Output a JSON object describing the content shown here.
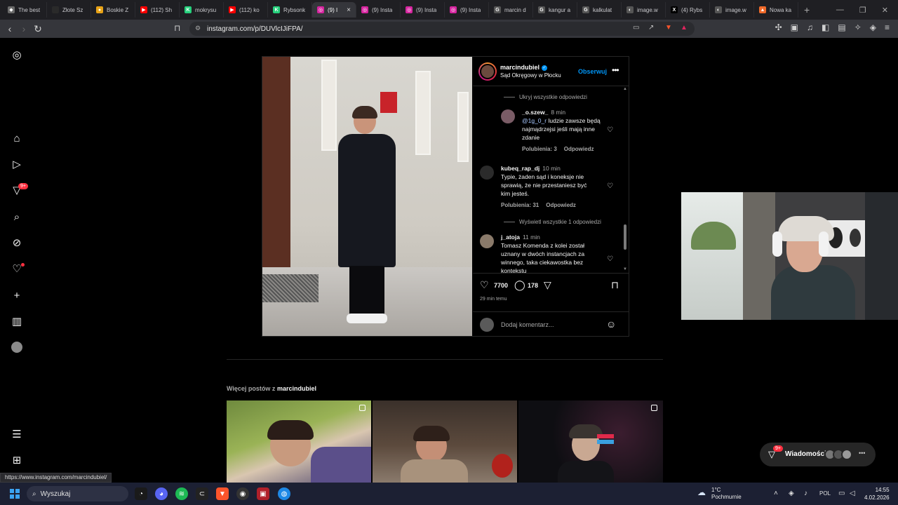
{
  "browser": {
    "tabs": [
      {
        "title": "The best",
        "color": "#6a6a6a",
        "glyph": "◆"
      },
      {
        "title": "Złote Sz",
        "color": "#2a2a2a",
        "glyph": ""
      },
      {
        "title": "Boskie Z",
        "color": "#e8a317",
        "glyph": "●"
      },
      {
        "title": "(112) Sh",
        "color": "#ff0000",
        "glyph": "▶"
      },
      {
        "title": "mokrysu",
        "color": "#26d07c",
        "glyph": "K"
      },
      {
        "title": "(112) ko",
        "color": "#ff0000",
        "glyph": "▶"
      },
      {
        "title": "Rybsonk",
        "color": "#26d07c",
        "glyph": "K"
      },
      {
        "title": "(9) I",
        "color": "#d6249f",
        "glyph": "◎",
        "active": true
      },
      {
        "title": "(9) Insta",
        "color": "#d6249f",
        "glyph": "◎"
      },
      {
        "title": "(9) Insta",
        "color": "#d6249f",
        "glyph": "◎"
      },
      {
        "title": "(9) Insta",
        "color": "#d6249f",
        "glyph": "◎"
      },
      {
        "title": "marcin d",
        "color": "#555",
        "glyph": "G"
      },
      {
        "title": "kangur a",
        "color": "#555",
        "glyph": "G"
      },
      {
        "title": "kalkulat",
        "color": "#555",
        "glyph": "G"
      },
      {
        "title": "image.w",
        "color": "#555",
        "glyph": "◐"
      },
      {
        "title": "(4) Rybs",
        "color": "#000",
        "glyph": "X"
      },
      {
        "title": "image.w",
        "color": "#555",
        "glyph": "◐"
      },
      {
        "title": "Nowa ka",
        "color": "#f06a2a",
        "glyph": "▲"
      }
    ],
    "url": "instagram.com/p/DUVlcIJiFPA/",
    "status_url": "https://www.instagram.com/marcindubiel/"
  },
  "post": {
    "username": "marcindubiel",
    "location": "Sąd Okręgowy w Płocku",
    "follow_label": "Obserwuj",
    "hide_replies": "Ukryj wszystkie odpowiedzi",
    "show_replies": "Wyświetl wszystkie 1 odpowiedzi",
    "comments": [
      {
        "user": "_o.szew_",
        "time": "8 min",
        "mention": "@1g_0_r",
        "text": "ludzie zawsze będą najmądrzejsi jeśli mają inne zdanie",
        "likes": "Polubienia: 3",
        "reply": "Odpowiedz"
      },
      {
        "user": "kubeq_rap_dj",
        "time": "10 min",
        "text": "Typie, żaden sąd i koneksje nie sprawią, że nie przestaniesz być kim jesteś.",
        "likes": "Polubienia: 31",
        "reply": "Odpowiedz"
      },
      {
        "user": "j_atoja",
        "time": "11 min",
        "text": "Tomasz Komenda z kolei został uznany w dwóch instancjach za winnego, taka ciekawostka bez kontekstu"
      }
    ],
    "like_count": "7700",
    "comment_count": "178",
    "time_ago": "29 min temu",
    "add_comment_placeholder": "Dodaj komentarz..."
  },
  "more_posts": {
    "prefix": "Więcej postów z",
    "user": "marcindubiel"
  },
  "messages": {
    "label": "Wiadomości",
    "badge": "9+"
  },
  "nav": {
    "notification_badge": "9+"
  },
  "taskbar": {
    "search_placeholder": "Wyszukaj",
    "temperature": "1°C",
    "weather": "Pochmurnie",
    "language": "POL",
    "time": "14:55",
    "date": "4.02.2026"
  }
}
